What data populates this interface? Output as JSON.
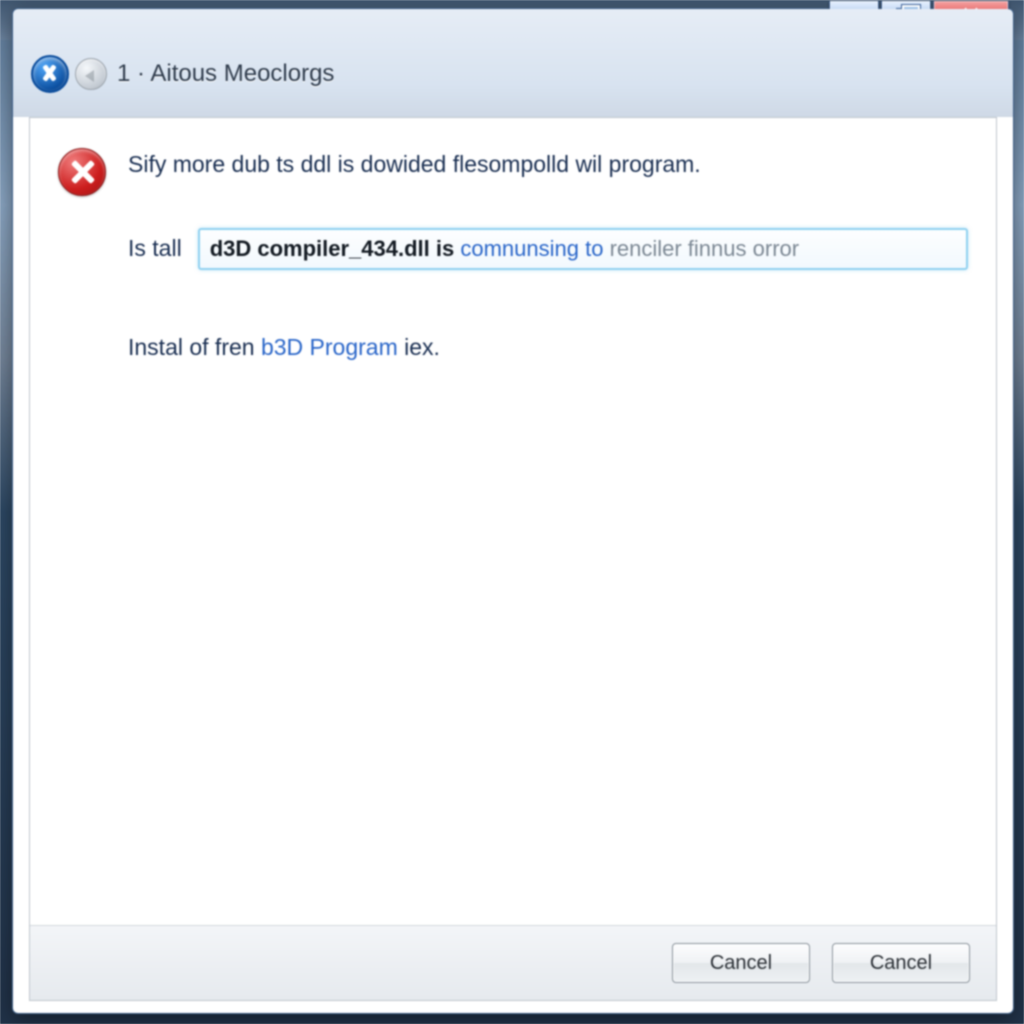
{
  "window": {
    "title": "1 · Aitous Meoclorgs"
  },
  "message": {
    "headline_1": "Sify more dub ts ddl is dowided flesompolld wil program.",
    "detail_label": "Is tall",
    "detail_bold": "d3D compiler_434.dll is ",
    "detail_link": "comnunsing to ",
    "detail_gray": "renciler finnus orror",
    "extra_prefix": "Instal of fren ",
    "extra_link": "b3D Program ",
    "extra_suffix": "iex."
  },
  "buttons": {
    "left": "Cancel",
    "right": "Cancel"
  }
}
